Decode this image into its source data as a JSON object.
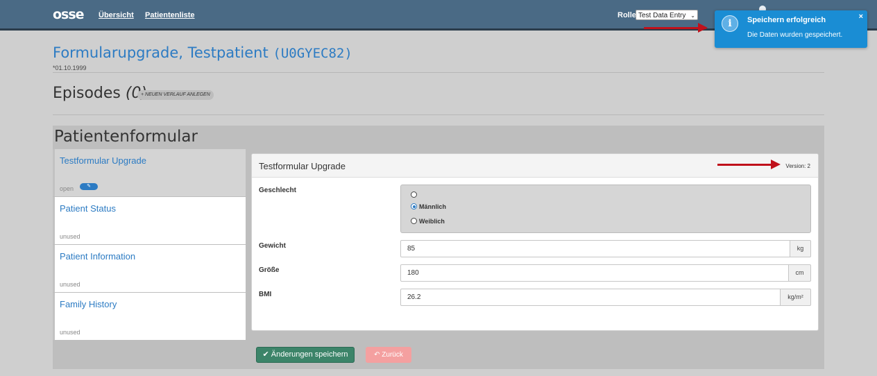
{
  "nav": {
    "logo": "osse",
    "overview": "Übersicht",
    "patient_list": "Patientenliste",
    "role_label": "Rolle",
    "role_value": "Test Data Entry"
  },
  "toast": {
    "title": "Speichern erfolgreich",
    "message": "Die Daten wurden gespeichert.",
    "close": "×"
  },
  "patient": {
    "name": "Formularupgrade, Testpatient",
    "id": "(U0GYEC82)",
    "dob": "*01.10.1999"
  },
  "episodes": {
    "label": "Episodes",
    "count": "(0)",
    "new_button": "+ NEUEN VERLAUF ANLEGEN"
  },
  "patient_form": {
    "title": "Patientenformular",
    "items": [
      {
        "name": "Testformular Upgrade",
        "status": "open"
      },
      {
        "name": "Patient Status",
        "status": "unused"
      },
      {
        "name": "Patient Information",
        "status": "unused"
      },
      {
        "name": "Family History",
        "status": "unused"
      }
    ]
  },
  "form": {
    "title": "Testformular Upgrade",
    "version": "Version: 2",
    "gender": {
      "label": "Geschlecht",
      "options": [
        "",
        "Männlich",
        "Weiblich"
      ],
      "selected": "Männlich"
    },
    "weight": {
      "label": "Gewicht",
      "value": "85",
      "unit": "kg"
    },
    "height": {
      "label": "Größe",
      "value": "180",
      "unit": "cm"
    },
    "bmi": {
      "label": "BMI",
      "value": "26.2",
      "unit": "kg/m²"
    }
  },
  "buttons": {
    "save": "Änderungen speichern",
    "back": "Zurück"
  },
  "colors": {
    "accent": "#2c7bc3",
    "header": "#4a6a85",
    "toast": "#1a8dd4",
    "save": "#3c8469",
    "back": "#f4a0a0",
    "arrow": "#c0111b"
  }
}
